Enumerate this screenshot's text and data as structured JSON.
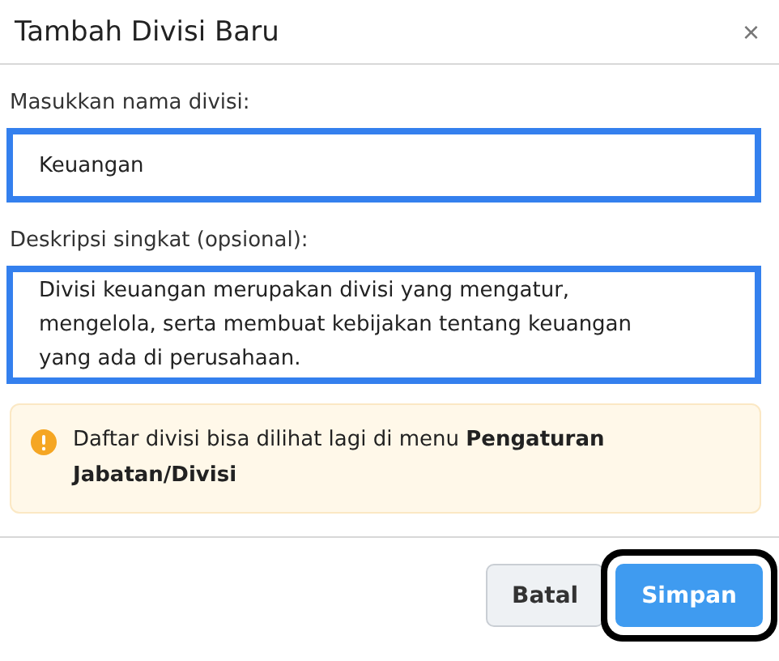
{
  "dialog": {
    "title": "Tambah Divisi Baru",
    "close_icon": "×"
  },
  "fields": [
    {
      "label": "Masukkan nama divisi:",
      "value": "Keuangan",
      "highlighted": true
    },
    {
      "label": "Deskripsi singkat (opsional):",
      "value": "Divisi keuangan merupakan divisi yang mengatur, mengelola, serta membuat kebijakan tentang keuangan yang ada di perusahaan.",
      "highlighted": true
    }
  ],
  "notice": {
    "text": "Daftar divisi bisa dilihat lagi di menu **Pengaturan Jabatan/Divisi**"
  },
  "buttons": [
    {
      "label": "Batal",
      "kind": "secondary",
      "highlighted": false
    },
    {
      "label": "Simpan",
      "kind": "primary",
      "highlighted": true
    }
  ]
}
